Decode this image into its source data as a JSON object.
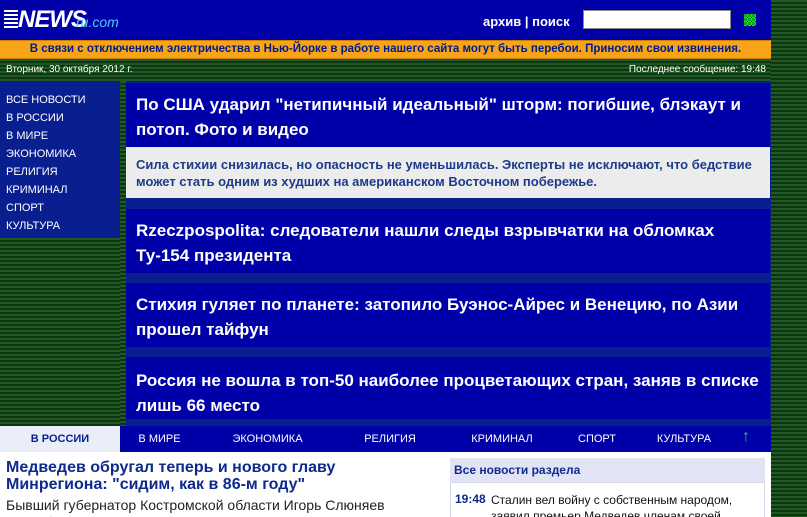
{
  "header": {
    "logo_main": "NEWS",
    "logo_sub": "ru.com",
    "archive_label": "архив",
    "separator": "|",
    "search_label": "поиск",
    "search_value": ""
  },
  "alert": "В связи с отключением электричества в Нью-Йорке в работе нашего сайта могут быть перебои. Приносим свои извинения.",
  "datebar": {
    "date": "Вторник, 30 октября 2012 г.",
    "last_message": "Последнее сообщение: 19:48"
  },
  "sidebar": {
    "items": [
      "ВСЕ НОВОСТИ",
      "В РОССИИ",
      "В МИРЕ",
      "ЭКОНОМИКА",
      "РЕЛИГИЯ",
      "КРИМИНАЛ",
      "СПОРТ",
      "КУЛЬТУРА"
    ]
  },
  "headlines": [
    "По США ударил \"нетипичный идеальный\" шторм: погибшие, блэкаут и потоп. Фото и видео",
    "Rzeczpospolita: следователи нашли следы взрывчатки на обломках Ту-154 президента",
    "Стихия гуляет по планете: затопило Буэнос-Айрес и Венецию, по Азии прошел тайфун",
    "Россия не вошла в топ-50 наиболее процветающих стран, заняв в списке лишь 66 место"
  ],
  "lead_summary": "Сила стихии снизилась, но опасность не уменьшилась. Эксперты не исключают, что бедствие может стать одним из худших на американском Восточном побережье.",
  "tabs": [
    "В РОССИИ",
    "В МИРЕ",
    "ЭКОНОМИКА",
    "РЕЛИГИЯ",
    "КРИМИНАЛ",
    "СПОРТ",
    "КУЛЬТУРА"
  ],
  "up_arrow": "↑",
  "article": {
    "title": "Медведев обругал теперь и нового главу Минрегиона: \"сидим, как в 86-м году\"",
    "lead": "Бывший губернатор Костромской области Игорь Слюняев доклабывал Дмитрию Медведеву по теме применения новых"
  },
  "section_news": {
    "title": "Все новости раздела",
    "time": "19:48",
    "text": "Сталин вел войну с собственным народом, заявил премьер Медведев членам своей"
  },
  "colors": {
    "primary_blue": "#0000a8",
    "alert_orange": "#f7a418",
    "green_stripes": "#1f5a25"
  }
}
